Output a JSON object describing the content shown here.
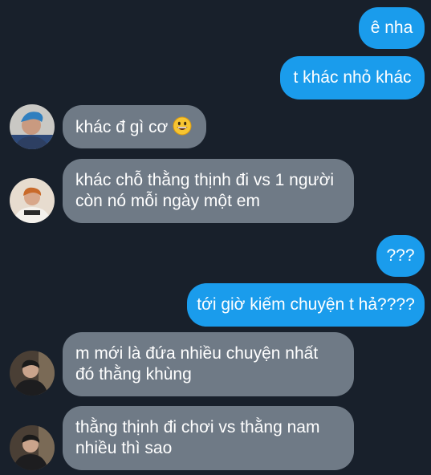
{
  "messages": {
    "m1": {
      "text": "ê nha"
    },
    "m2": {
      "text": "t khác nhỏ khác"
    },
    "m3": {
      "text": "khác đ gì cơ",
      "emoji": "grinning-face"
    },
    "m4": {
      "line1": "khác chỗ thằng thịnh đi vs 1 người",
      "line2": "còn nó mỗi ngày một em"
    },
    "m5": {
      "text": "???"
    },
    "m6": {
      "text": "tới giờ kiếm chuyện t hả????"
    },
    "m7": {
      "line1": "m mới là đứa nhiều chuyện nhất",
      "line2": "đó thằng khùng"
    },
    "m8": {
      "line1": "thằng thịnh đi chơi vs thằng nam",
      "line2": "nhiều thì sao"
    }
  },
  "colors": {
    "background": "#18202b",
    "outgoing_bubble": "#1a9cec",
    "incoming_bubble": "#6f7a86",
    "text": "#ffffff"
  }
}
